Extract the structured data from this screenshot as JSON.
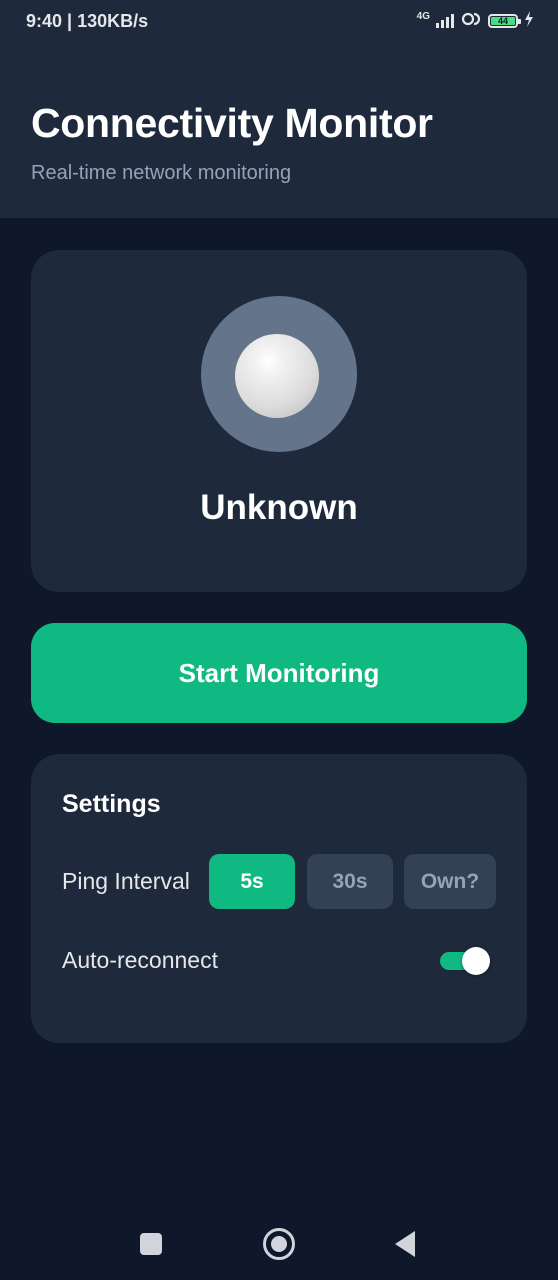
{
  "status_bar": {
    "time_speed": "9:40 | 130KB/s",
    "network_type": "4G",
    "battery_level": "44",
    "icons": [
      "signal-icon",
      "sync-icon",
      "battery-icon",
      "charging-icon"
    ]
  },
  "header": {
    "title": "Connectivity Monitor",
    "subtitle": "Real-time network monitoring"
  },
  "status_card": {
    "status_text": "Unknown"
  },
  "actions": {
    "start_label": "Start Monitoring"
  },
  "settings": {
    "title": "Settings",
    "ping_interval": {
      "label": "Ping Interval",
      "options": [
        "5s",
        "30s",
        "Own?"
      ],
      "selected": "5s"
    },
    "auto_reconnect": {
      "label": "Auto-reconnect",
      "enabled": true
    }
  },
  "colors": {
    "background": "#0f172a",
    "surface": "#1e293b",
    "accent": "#10b981",
    "muted": "#334155",
    "indicator": "#64748b"
  },
  "navigation": {
    "icons": [
      "recents-square-icon",
      "home-circle-icon",
      "back-triangle-icon"
    ]
  }
}
